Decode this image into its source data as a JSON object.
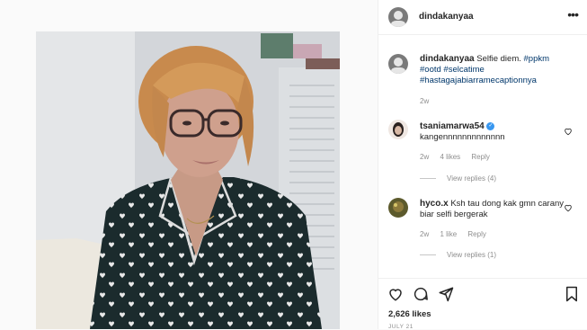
{
  "post": {
    "username": "dindakanyaa",
    "more_icon": "more-horizontal-icon",
    "caption_user": "dindakanyaa",
    "caption_text": "Selfie diem.",
    "caption_tag_1": "#ppkm",
    "caption_tag_2": "#ootd",
    "caption_tag_3": "#selcatime",
    "caption_tag_4": "#hastagajabiarramecaptionnya",
    "caption_time": "2w"
  },
  "comments": [
    {
      "username": "tsaniamarwa54",
      "verified": true,
      "text": "kangennnnnnnnnnnnn",
      "time": "2w",
      "likes": "4 likes",
      "reply": "Reply",
      "view_replies": "View replies (4)"
    },
    {
      "username": "hyco.x",
      "verified": false,
      "text": "Ksh tau dong kak gmn carany biar selfi bergerak",
      "time": "2w",
      "likes": "1 like",
      "reply": "Reply",
      "view_replies": "View replies (1)"
    }
  ],
  "footer": {
    "likes": "2,626 likes",
    "date": "JULY 21",
    "icons": [
      "heart-icon",
      "comment-icon",
      "share-icon",
      "bookmark-icon"
    ]
  },
  "colors": {
    "link": "#00376b",
    "verified": "#3897f0",
    "muted": "#8e8e8e",
    "pajama": "#1b2b2d"
  }
}
